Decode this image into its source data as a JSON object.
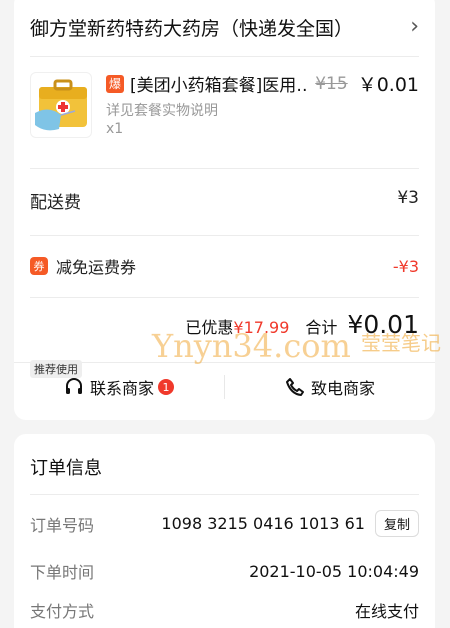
{
  "shop": {
    "name": "御方堂新药特药大药房（快递发全国）"
  },
  "product": {
    "badge": "爆",
    "title": "[美团小药箱套餐]医用…",
    "original_price": "¥15",
    "price": "￥0.01",
    "subtitle": "详见套餐实物说明",
    "quantity": "x1"
  },
  "delivery_fee": {
    "label": "配送费",
    "value": "¥3"
  },
  "coupon": {
    "badge": "券",
    "label": "减免运费券",
    "value": "-¥3"
  },
  "summary": {
    "saved_label": "已优惠",
    "saved_amount": "¥17.99",
    "total_label": "合计",
    "total_amount": "¥0.01"
  },
  "actions": {
    "recommend_tag": "推荐使用",
    "contact_label": "联系商家",
    "contact_badge": "1",
    "call_label": "致电商家"
  },
  "order_info": {
    "title": "订单信息",
    "rows": [
      {
        "label": "订单号码",
        "value": "1098 3215 0416 1013 61",
        "button": "复制"
      },
      {
        "label": "下单时间",
        "value": "2021-10-05 10:04:49"
      },
      {
        "label": "支付方式",
        "value": "在线支付"
      }
    ]
  },
  "watermark": {
    "text": "Ynyn34.com",
    "tag": "莹莹笔记"
  }
}
